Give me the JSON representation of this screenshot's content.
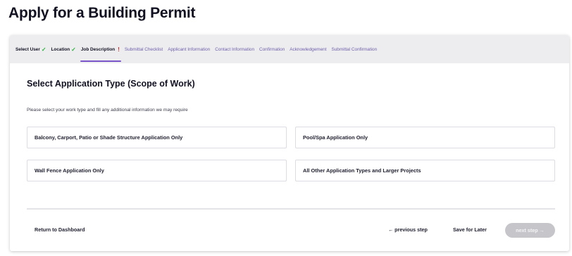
{
  "page": {
    "title": "Apply for a Building Permit"
  },
  "stepper": {
    "steps": [
      {
        "label": "Select User",
        "state": "done",
        "mark": "✓"
      },
      {
        "label": "Location",
        "state": "done",
        "mark": "✓"
      },
      {
        "label": "Job Description",
        "state": "current",
        "mark": "!"
      },
      {
        "label": "Submittal Checklist",
        "state": "upcoming"
      },
      {
        "label": "Applicant Information",
        "state": "upcoming"
      },
      {
        "label": "Contact Information",
        "state": "upcoming"
      },
      {
        "label": "Confirmation",
        "state": "upcoming"
      },
      {
        "label": "Acknowledgement",
        "state": "upcoming"
      },
      {
        "label": "Submittal Confirmation",
        "state": "upcoming"
      }
    ]
  },
  "section": {
    "title": "Select Application Type (Scope of Work)",
    "description": "Please select your work type and fill any additional information we may require"
  },
  "options": [
    {
      "label": "Balcony, Carport, Patio or Shade Structure Application Only"
    },
    {
      "label": "Pool/Spa Application Only"
    },
    {
      "label": "Wall Fence Application Only"
    },
    {
      "label": "All Other Application Types and Larger Projects"
    }
  ],
  "footer": {
    "return_label": "Return to Dashboard",
    "previous_label": "← previous step",
    "save_label": "Save for Later",
    "next_label": "next step →",
    "next_disabled": true
  },
  "colors": {
    "accent": "#7a55c9",
    "check": "#2bb03d",
    "alert": "#d62828",
    "upcoming_step": "#6f5fa8",
    "disabled_button": "#c6c6ca"
  }
}
